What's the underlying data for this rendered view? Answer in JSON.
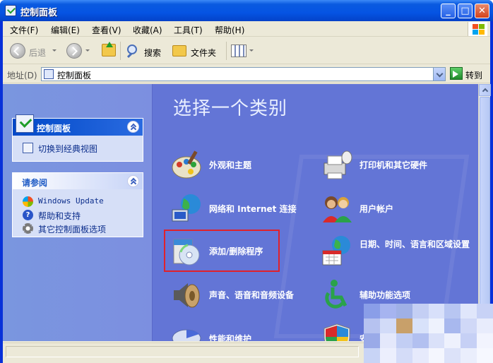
{
  "window": {
    "title": "控制面板"
  },
  "menu": [
    "文件(F)",
    "编辑(E)",
    "查看(V)",
    "收藏(A)",
    "工具(T)",
    "帮助(H)"
  ],
  "toolbar": {
    "back": "后退",
    "search": "搜索",
    "folders": "文件夹"
  },
  "address": {
    "label": "地址(D)",
    "value": "控制面板",
    "go": "转到"
  },
  "sidebar": {
    "panel1": {
      "title": "控制面板",
      "items": [
        "切换到经典视图"
      ]
    },
    "panel2": {
      "title": "请参阅",
      "items": [
        "Windows Update",
        "帮助和支持",
        "其它控制面板选项"
      ]
    }
  },
  "main": {
    "title": "选择一个类别",
    "categories": [
      {
        "label": "外观和主题",
        "icon": "palette-icon"
      },
      {
        "label": "打印机和其它硬件",
        "icon": "printer-icon"
      },
      {
        "label": "网络和 Internet 连接",
        "icon": "network-globe-icon"
      },
      {
        "label": "用户帐户",
        "icon": "users-icon"
      },
      {
        "label": "添加/删除程序",
        "icon": "cd-box-icon"
      },
      {
        "label": "日期、时间、语言和区域设置",
        "icon": "calendar-globe-icon"
      },
      {
        "label": "声音、语音和音频设备",
        "icon": "speaker-icon"
      },
      {
        "label": "辅助功能选项",
        "icon": "accessibility-icon"
      },
      {
        "label": "性能和维护",
        "icon": "pie-chart-icon"
      },
      {
        "label": "安",
        "icon": "shield-icon"
      }
    ]
  },
  "colors": {
    "title_bar": "#0554e3",
    "content_bg": "#6375d6",
    "highlight": "#e0212b"
  }
}
